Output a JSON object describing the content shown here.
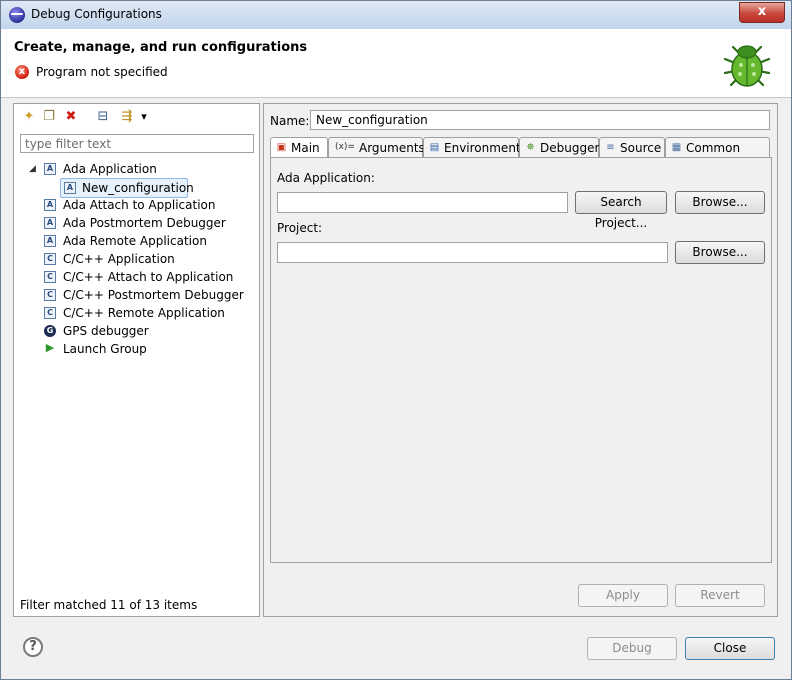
{
  "window": {
    "title": "Debug Configurations",
    "close_glyph": "x"
  },
  "header": {
    "title": "Create, manage, and run configurations",
    "message": "Program not specified",
    "error_glyph": "x"
  },
  "toolbar": {
    "new": "new-config-icon",
    "duplicate": "duplicate-icon",
    "delete": "delete-icon",
    "collapse": "collapse-all-icon",
    "filter": "filter-icon",
    "dropdown": "▾"
  },
  "filter": {
    "placeholder": "type filter text"
  },
  "tree": [
    {
      "label": "Ada Application",
      "icon": "A",
      "level": 0,
      "expanded": true
    },
    {
      "label": "New_configuration",
      "icon": "A",
      "level": 1,
      "selected": true
    },
    {
      "label": "Ada Attach to Application",
      "icon": "A",
      "level": 0
    },
    {
      "label": "Ada Postmortem Debugger",
      "icon": "A",
      "level": 0
    },
    {
      "label": "Ada Remote Application",
      "icon": "A",
      "level": 0
    },
    {
      "label": "C/C++ Application",
      "icon": "C",
      "level": 0
    },
    {
      "label": "C/C++ Attach to Application",
      "icon": "C",
      "level": 0
    },
    {
      "label": "C/C++ Postmortem Debugger",
      "icon": "C",
      "level": 0
    },
    {
      "label": "C/C++ Remote Application",
      "icon": "C",
      "level": 0
    },
    {
      "label": "GPS debugger",
      "icon": "G",
      "level": 0
    },
    {
      "label": "Launch Group",
      "icon": "▶",
      "level": 0
    }
  ],
  "status": "Filter matched 11 of 13 items",
  "name": {
    "label": "Name:",
    "value": "New_configuration"
  },
  "tabs": [
    {
      "label": "Main",
      "icon": "main-tab-icon",
      "glyph": "▣",
      "active": true
    },
    {
      "label": "Arguments",
      "icon": "arguments-tab-icon",
      "glyph": "(x)="
    },
    {
      "label": "Environment",
      "icon": "environment-tab-icon",
      "glyph": "▤"
    },
    {
      "label": "Debugger",
      "icon": "debugger-tab-icon",
      "glyph": "✵"
    },
    {
      "label": "Source",
      "icon": "source-tab-icon",
      "glyph": "≡"
    },
    {
      "label": "Common",
      "icon": "common-tab-icon",
      "glyph": "▦"
    }
  ],
  "main": {
    "ada_label": "Ada Application:",
    "ada_value": "",
    "search_button": "Search Project...",
    "browse_button": "Browse...",
    "project_label": "Project:",
    "project_value": "",
    "browse_button2": "Browse..."
  },
  "actions": {
    "apply": "Apply",
    "revert": "Revert",
    "debug": "Debug",
    "close": "Close",
    "help": "?"
  }
}
